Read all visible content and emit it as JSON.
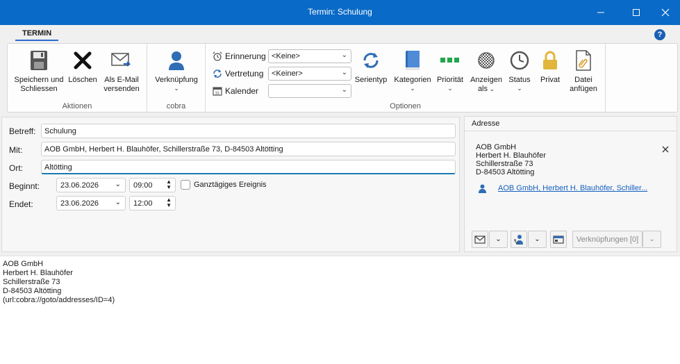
{
  "window": {
    "title": "Termin: Schulung"
  },
  "ribbon": {
    "tab": "TERMIN",
    "groups": {
      "aktionen": "Aktionen",
      "cobra": "cobra",
      "optionen": "Optionen"
    },
    "buttons": {
      "save_line1": "Speichern und",
      "save_line2": "Schliessen",
      "delete": "Löschen",
      "email_line1": "Als E-Mail",
      "email_line2": "versenden",
      "link": "Verknüpfung",
      "series": "Serientyp",
      "categories": "Kategorien",
      "priority": "Priorität",
      "show_line1": "Anzeigen",
      "show_line2": "als",
      "status": "Status",
      "private": "Privat",
      "attach_line1": "Datei",
      "attach_line2": "anfügen"
    },
    "options": {
      "reminder_label": "Erinnerung",
      "reminder_value": "<Keine>",
      "substitute_label": "Vertretung",
      "substitute_value": "<Keiner>",
      "calendar_label": "Kalender",
      "calendar_value": ""
    }
  },
  "form": {
    "subject_label": "Betreff:",
    "subject_value": "Schulung",
    "with_label": "Mit:",
    "with_value": "AOB GmbH, Herbert H. Blauhöfer, Schillerstraße 73, D-84503 Altötting",
    "location_label": "Ort:",
    "location_value": "Altötting",
    "start_label": "Beginnt:",
    "start_date": "23.06.2026",
    "start_time": "09:00",
    "allday_label": "Ganztägiges Ereignis",
    "end_label": "Endet:",
    "end_date": "23.06.2026",
    "end_time": "12:00"
  },
  "address": {
    "header": "Adresse",
    "lines": [
      "AOB GmbH",
      "Herbert H. Blauhöfer",
      "Schillerstraße 73",
      "D-84503 Altötting"
    ],
    "link": "AOB GmbH, Herbert H. Blauhöfer, Schiller...",
    "links_button": "Verknüpfungen [0]"
  },
  "notes": {
    "lines": [
      "AOB GmbH",
      "Herbert H. Blauhöfer",
      "Schillerstraße 73",
      "D-84503 Altötting",
      "(url:cobra://goto/addresses/ID=4)"
    ]
  },
  "colors": {
    "titlebar": "#0a6ac7",
    "accent": "#2a6bd1",
    "link": "#1560c0",
    "priority_green": "#1fa64a",
    "lock_gold": "#e2b53b"
  }
}
